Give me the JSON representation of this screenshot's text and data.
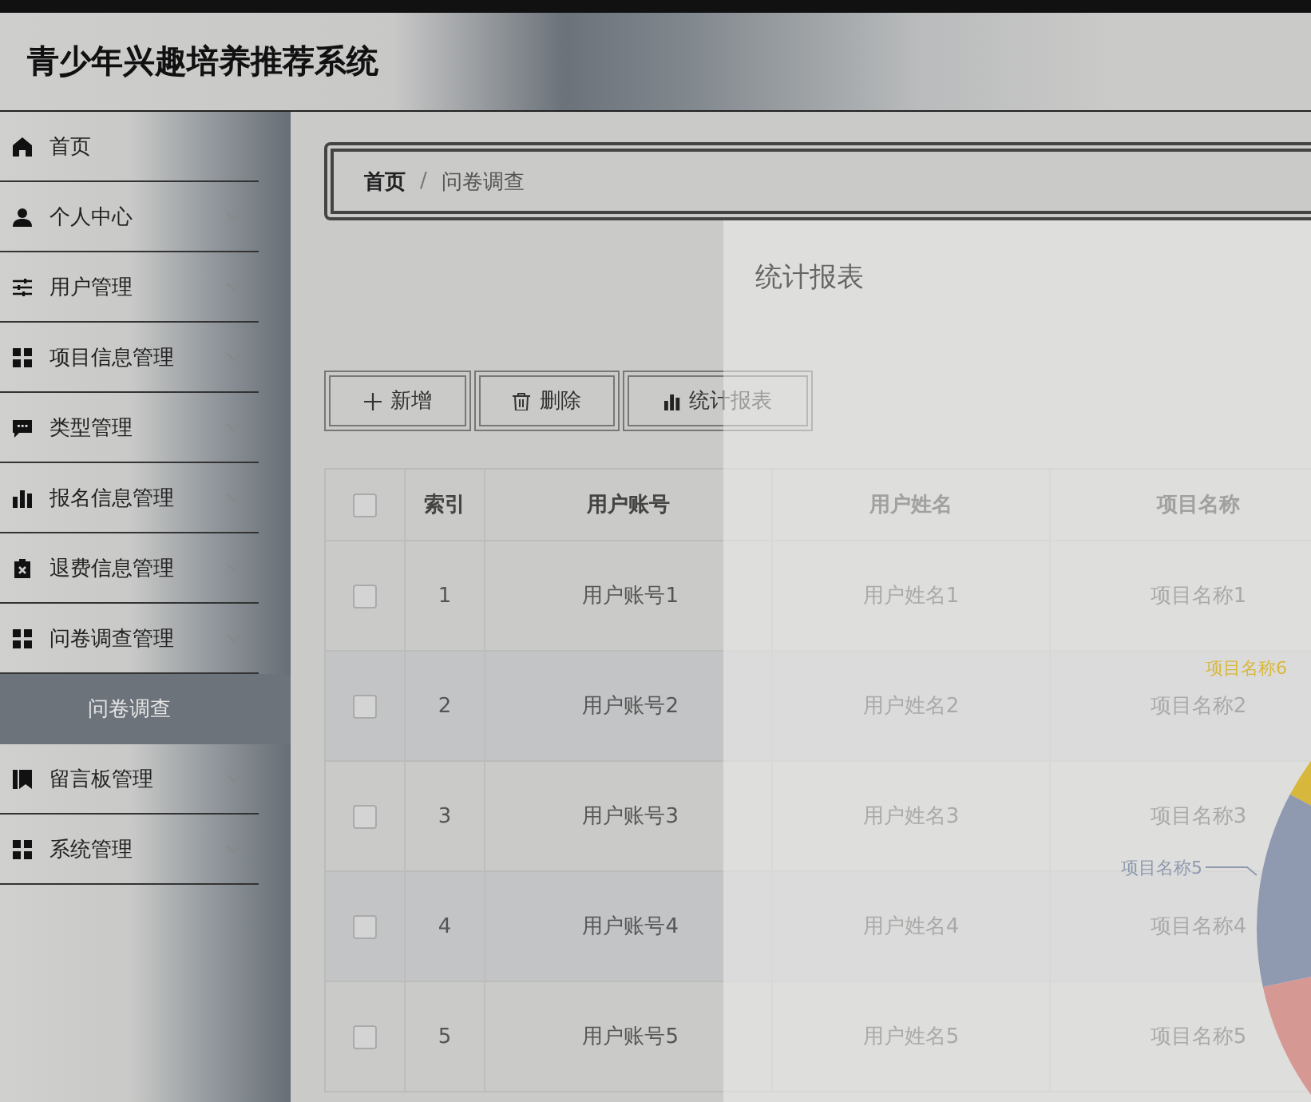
{
  "header": {
    "title": "青少年兴趣培养推荐系统"
  },
  "sidebar": {
    "items": [
      {
        "label": "首页",
        "expandable": false,
        "selected": false
      },
      {
        "label": "个人中心",
        "expandable": true,
        "selected": false
      },
      {
        "label": "用户管理",
        "expandable": true,
        "selected": false
      },
      {
        "label": "项目信息管理",
        "expandable": true,
        "selected": false
      },
      {
        "label": "类型管理",
        "expandable": true,
        "selected": false
      },
      {
        "label": "报名信息管理",
        "expandable": true,
        "selected": false
      },
      {
        "label": "退费信息管理",
        "expandable": true,
        "selected": false
      },
      {
        "label": "问卷调查管理",
        "expandable": true,
        "selected": false,
        "children": [
          {
            "label": "问卷调查",
            "selected": true
          }
        ]
      },
      {
        "label": "留言板管理",
        "expandable": true,
        "selected": false
      },
      {
        "label": "系统管理",
        "expandable": true,
        "selected": false
      }
    ]
  },
  "breadcrumb": {
    "items": [
      "首页",
      "问卷调查"
    ],
    "separator": "/"
  },
  "toolbar": {
    "buttons": [
      {
        "label": "新增",
        "kind": "add"
      },
      {
        "label": "删除",
        "kind": "delete"
      },
      {
        "label": "统计报表",
        "kind": "chart"
      }
    ]
  },
  "table": {
    "header_checked": false,
    "columns": [
      "索引",
      "用户账号",
      "用户姓名",
      "项目名称"
    ],
    "rows": [
      {
        "checked": false,
        "cells": [
          "1",
          "用户账号1",
          "用户姓名1",
          "项目名称1"
        ]
      },
      {
        "checked": false,
        "cells": [
          "2",
          "用户账号2",
          "用户姓名2",
          "项目名称2"
        ]
      },
      {
        "checked": false,
        "cells": [
          "3",
          "用户账号3",
          "用户姓名3",
          "项目名称3"
        ]
      },
      {
        "checked": false,
        "cells": [
          "4",
          "用户账号4",
          "用户姓名4",
          "项目名称4"
        ]
      },
      {
        "checked": false,
        "cells": [
          "5",
          "用户账号5",
          "用户姓名5",
          "项目名称5"
        ]
      }
    ]
  },
  "dialog": {
    "title": "统计报表",
    "slices": [
      {
        "label": "项目名称6",
        "color": "#d8b83c"
      },
      {
        "label": "项目名称5",
        "color": "#8f9ab0"
      },
      {
        "color": "#d69893"
      }
    ]
  }
}
